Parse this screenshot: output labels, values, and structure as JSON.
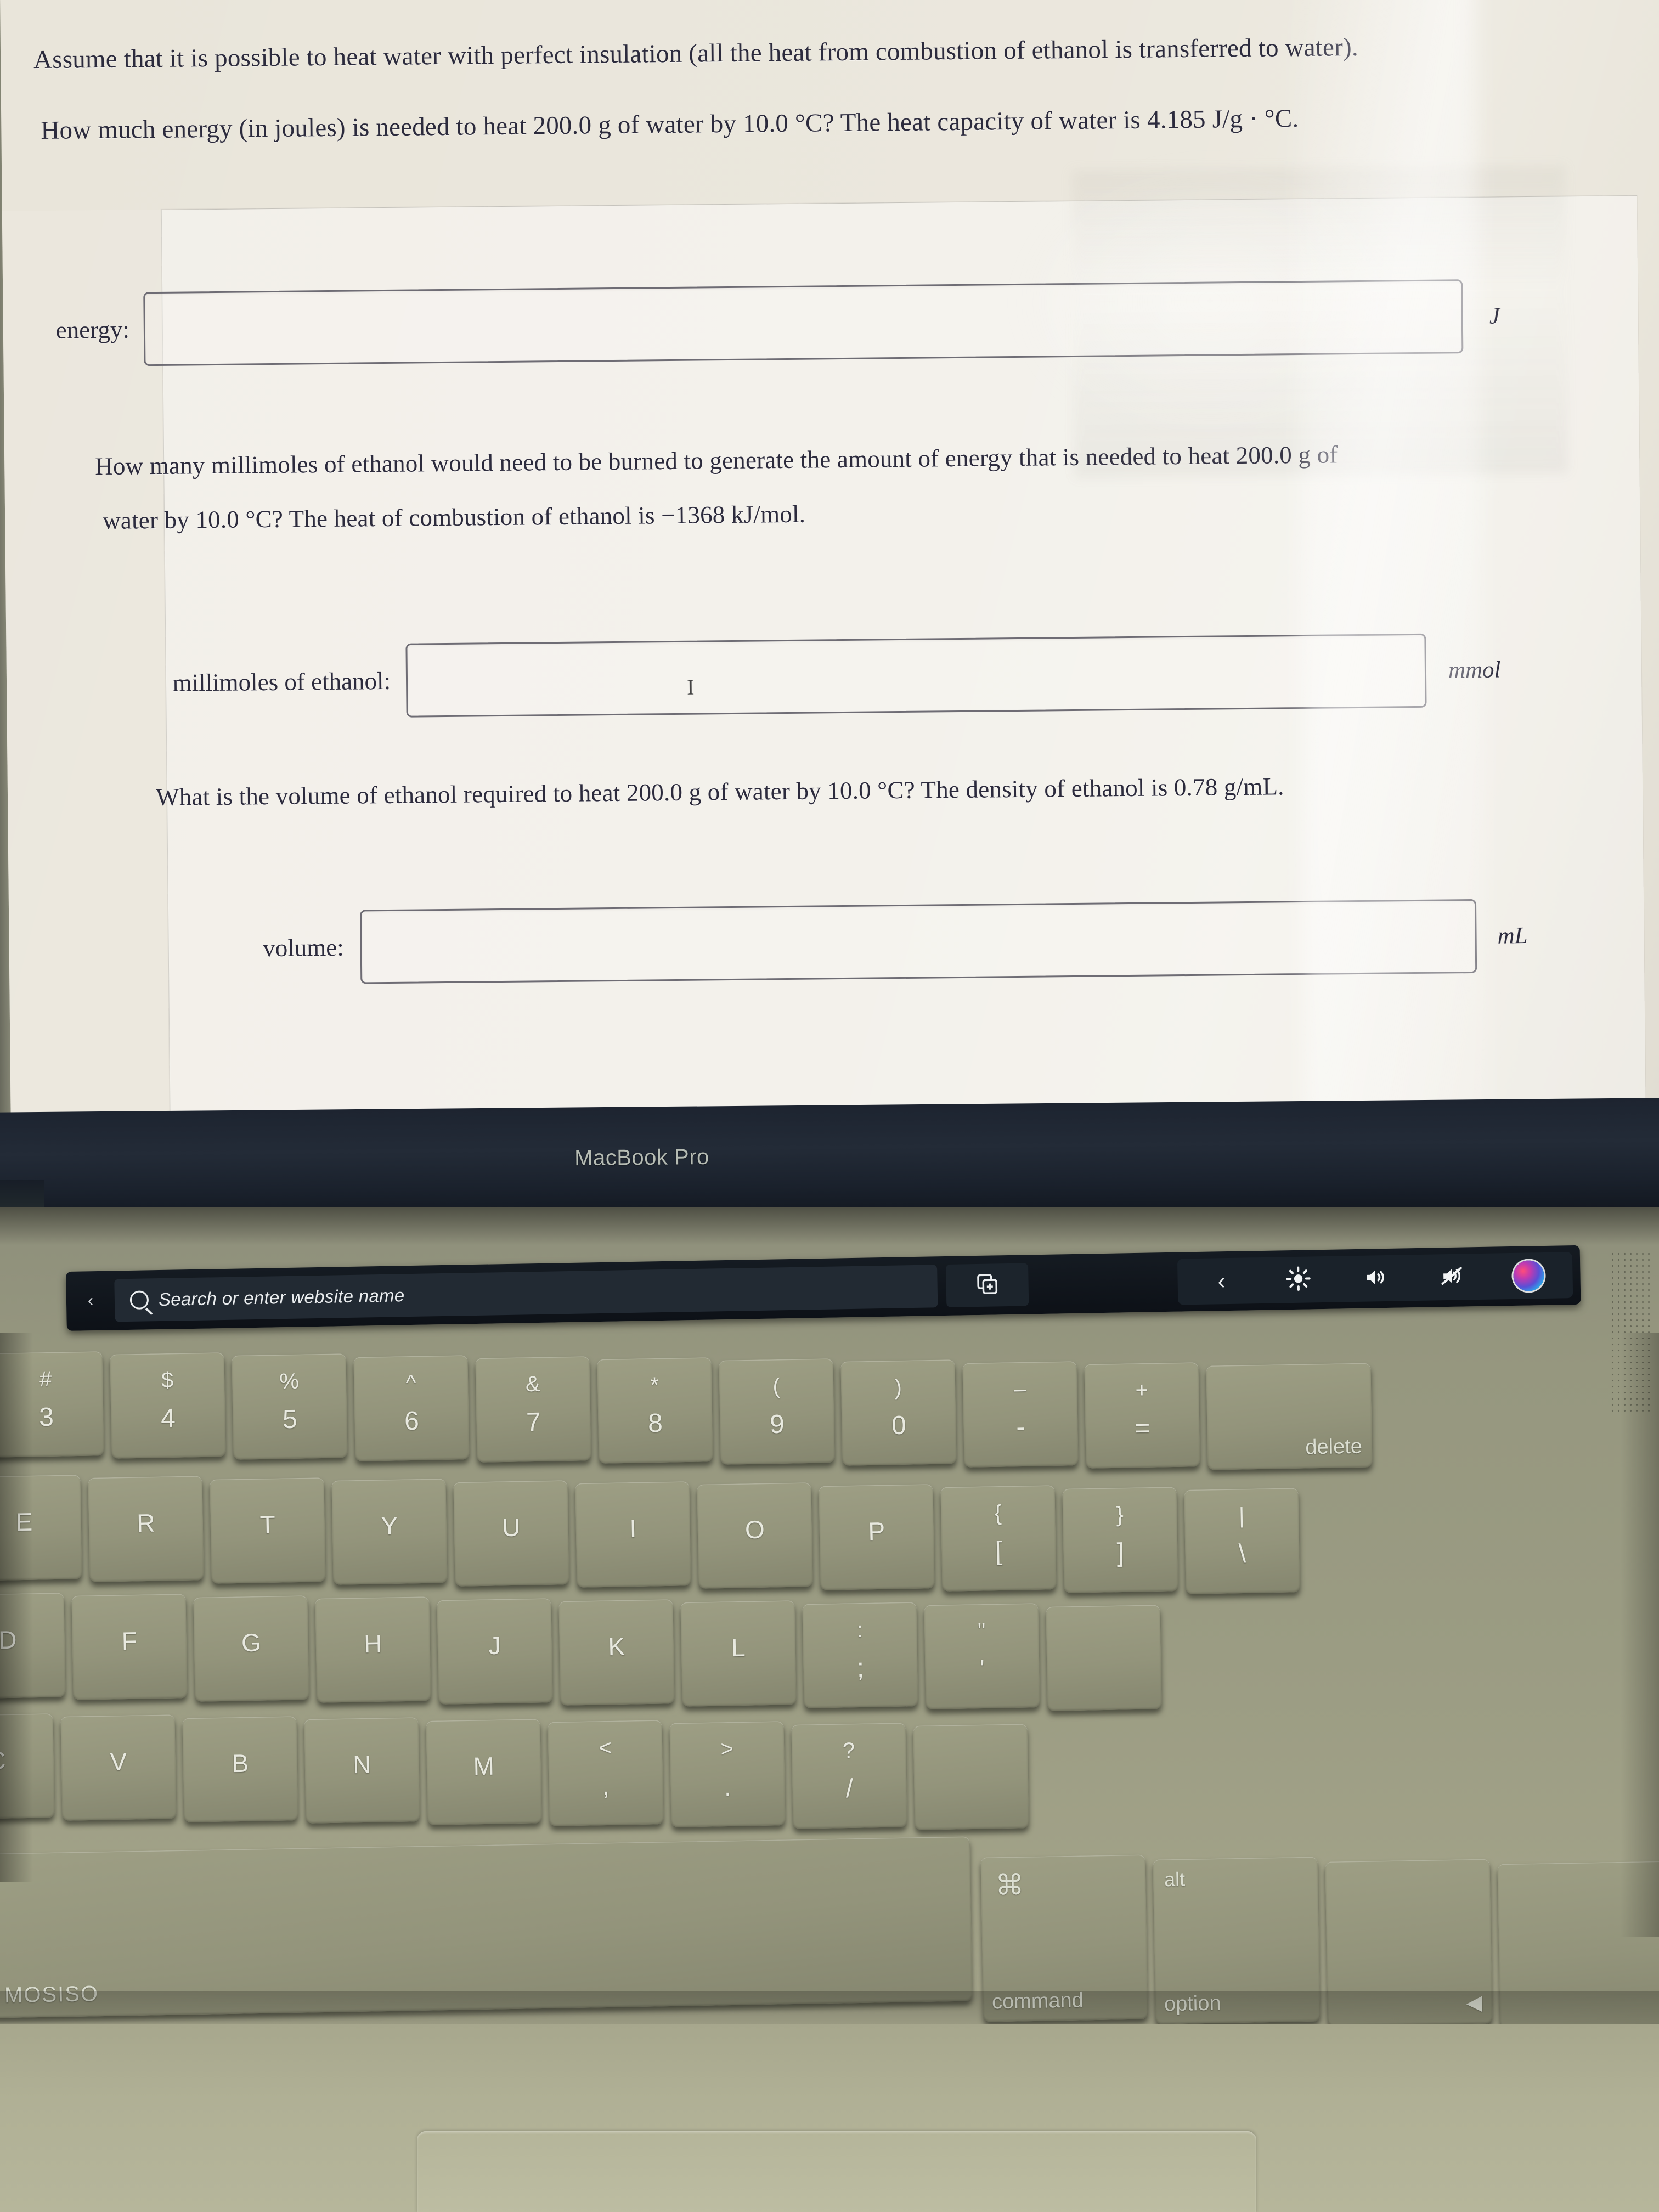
{
  "device": {
    "lid_logo": "MacBook Pro",
    "brand_key_label": "MOSISO"
  },
  "problem": {
    "line1": "Assume that it is possible to heat water with perfect insulation (all the heat from combustion of ethanol is transferred to water).",
    "line2": "How much energy (in joules) is needed to heat 200.0 g of water by 10.0 °C? The heat capacity of water is 4.185 J/g · °C.",
    "q2_line1": "How many millimoles of ethanol would need to be burned to generate the amount of energy that is needed to heat 200.0 g of",
    "q2_line2": "water by 10.0 °C? The heat of combustion of ethanol is −1368 kJ/mol.",
    "q3_line1": "What is the volume of ethanol required to heat 200.0 g of water by 10.0 °C? The density of ethanol is 0.78 g/mL."
  },
  "answers": [
    {
      "label": "energy:",
      "value": "",
      "placeholder": "",
      "unit": "J"
    },
    {
      "label": "millimoles of ethanol:",
      "value": "",
      "placeholder": "",
      "unit": "mmol"
    },
    {
      "label": "volume:",
      "value": "",
      "placeholder": "",
      "unit": "mL"
    }
  ],
  "touchbar": {
    "esc_label": "‹",
    "search_placeholder": "Search or enter website name",
    "new_tab_icon": "new-tab-icon",
    "controls": [
      {
        "name": "back-chevron",
        "glyph": "‹"
      },
      {
        "name": "brightness",
        "glyph": "brightness-icon"
      },
      {
        "name": "volume",
        "glyph": "volume-icon"
      },
      {
        "name": "mute",
        "glyph": "mute-icon"
      },
      {
        "name": "siri",
        "glyph": "siri-icon"
      }
    ]
  },
  "keyboard": {
    "number_row": [
      {
        "top": "#",
        "bottom": "3"
      },
      {
        "top": "$",
        "bottom": "4"
      },
      {
        "top": "%",
        "bottom": "5"
      },
      {
        "top": "^",
        "bottom": "6"
      },
      {
        "top": "&",
        "bottom": "7"
      },
      {
        "top": "*",
        "bottom": "8"
      },
      {
        "top": "(",
        "bottom": "9"
      },
      {
        "top": ")",
        "bottom": "0"
      },
      {
        "top": "–",
        "bottom": "-"
      },
      {
        "top": "+",
        "bottom": "="
      }
    ],
    "delete_label": "delete",
    "row_q": [
      {
        "label": "E"
      },
      {
        "label": "R"
      },
      {
        "label": "T"
      },
      {
        "label": "Y"
      },
      {
        "label": "U"
      },
      {
        "label": "I"
      },
      {
        "label": "O"
      },
      {
        "label": "P"
      },
      {
        "top": "{",
        "bottom": "["
      },
      {
        "top": "}",
        "bottom": "]"
      },
      {
        "top": "|",
        "bottom": "\\"
      }
    ],
    "row_a": [
      {
        "label": "D"
      },
      {
        "label": "F"
      },
      {
        "label": "G"
      },
      {
        "label": "H"
      },
      {
        "label": "J"
      },
      {
        "label": "K"
      },
      {
        "label": "L"
      },
      {
        "top": ":",
        "bottom": ";"
      },
      {
        "top": "\"",
        "bottom": "'"
      },
      {
        "label": ""
      }
    ],
    "row_z": [
      {
        "label": "C"
      },
      {
        "label": "V"
      },
      {
        "label": "B"
      },
      {
        "label": "N"
      },
      {
        "label": "M"
      },
      {
        "top": "<",
        "bottom": ","
      },
      {
        "top": ">",
        "bottom": "."
      },
      {
        "top": "?",
        "bottom": "/"
      },
      {
        "label": ""
      }
    ],
    "bottom_row": [
      {
        "name": "brand-key",
        "brand": "MOSISO"
      },
      {
        "name": "command-key",
        "symbol": "⌘",
        "word": "command"
      },
      {
        "name": "option-key",
        "small": "alt",
        "word": "option"
      },
      {
        "name": "arrow-key",
        "symbol": "◀"
      }
    ]
  }
}
